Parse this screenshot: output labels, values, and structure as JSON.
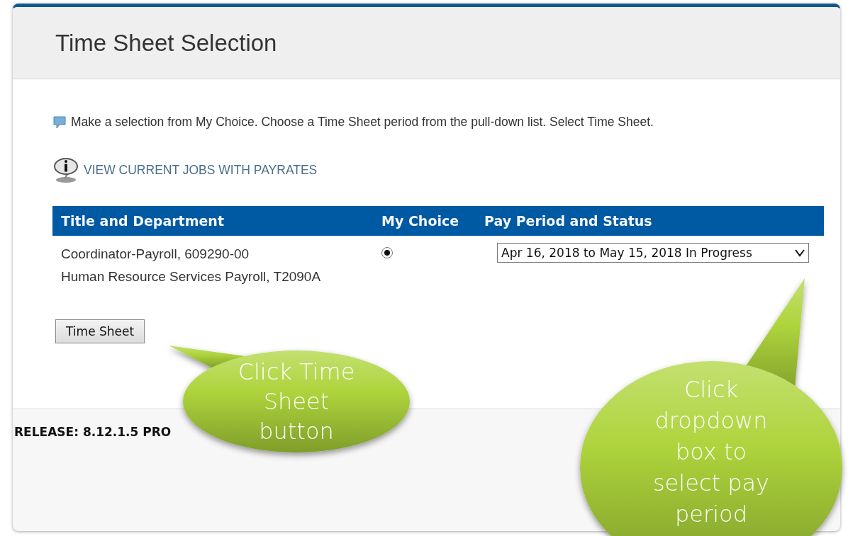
{
  "panel": {
    "title": "Time Sheet Selection"
  },
  "instruction": "Make a selection from My Choice. Choose a Time Sheet period from the pull-down list. Select Time Sheet.",
  "jobs_link": "VIEW CURRENT JOBS WITH PAYRATES",
  "table": {
    "columns": [
      "Title and Department",
      "My Choice",
      "Pay Period and Status"
    ],
    "rows": [
      {
        "title_lines": [
          "Coordinator-Payroll, 609290-00",
          "Human Resource Services Payroll, T2090A"
        ],
        "selected": true,
        "pay_period": "Apr 16, 2018 to May 15, 2018 In Progress"
      }
    ]
  },
  "button": "Time Sheet",
  "release": "RELEASE: 8.12.1.5 PRO",
  "callouts": [
    {
      "kind": "small",
      "text": "Click Time Sheet button"
    },
    {
      "kind": "large",
      "text": "Click dropdown box to select pay period"
    }
  ]
}
